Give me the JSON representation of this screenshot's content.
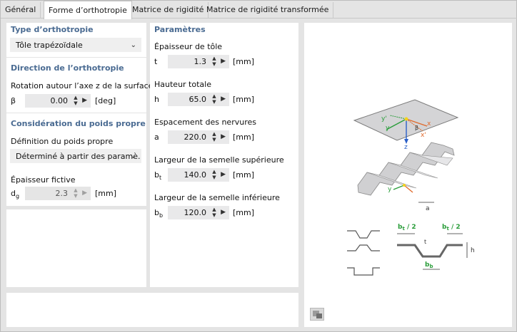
{
  "tabs": [
    {
      "label": "Général"
    },
    {
      "label": "Forme d’orthotropie"
    },
    {
      "label": "Matrice de rigidité"
    },
    {
      "label": "Matrice de rigidité transformée"
    }
  ],
  "type": {
    "title": "Type d’orthotropie",
    "value": "Tôle trapézoïdale"
  },
  "direction": {
    "title": "Direction de l’orthotropie",
    "rotation_label": "Rotation autour l’axe z de la surface",
    "symbol": "β",
    "value": "0.00",
    "unit": "[deg]"
  },
  "self_weight": {
    "title": "Considération du poids propre",
    "definition_label": "Définition du poids propre",
    "definition_value": "Déterminé à partir des paramè...",
    "fictive_label": "Épaisseur fictive",
    "symbol": "d",
    "symbol_sub": "g",
    "value": "2.3",
    "unit": "[mm]"
  },
  "params": {
    "title": "Paramètres",
    "items": [
      {
        "label": "Épaisseur de tôle",
        "symbol": "t",
        "sub": "",
        "value": "1.3",
        "unit": "[mm]"
      },
      {
        "label": "Hauteur totale",
        "symbol": "h",
        "sub": "",
        "value": "65.0",
        "unit": "[mm]"
      },
      {
        "label": "Espacement des nervures",
        "symbol": "a",
        "sub": "",
        "value": "220.0",
        "unit": "[mm]"
      },
      {
        "label": "Largeur de la semelle supérieure",
        "symbol": "b",
        "sub": "t",
        "value": "140.0",
        "unit": "[mm]"
      },
      {
        "label": "Largeur de la semelle inférieure",
        "symbol": "b",
        "sub": "b",
        "value": "120.0",
        "unit": "[mm]"
      }
    ]
  },
  "figure": {
    "axes": {
      "y_prime": "y'",
      "y": "y",
      "x": "x",
      "x_prime": "x'",
      "z": "z",
      "beta": "β"
    },
    "sheet_y": "y",
    "a": "a",
    "bt_half": "b",
    "bt_half_sub": "t",
    "bt_half_suffix": " / 2",
    "t": "t",
    "h": "h",
    "bb": "b",
    "bb_sub": "b"
  },
  "colors": {
    "section_title": "#4a6b92",
    "accent_green": "#2a9d3a",
    "axis_orange": "#e06a2c",
    "axis_blue": "#2a5fc7"
  }
}
